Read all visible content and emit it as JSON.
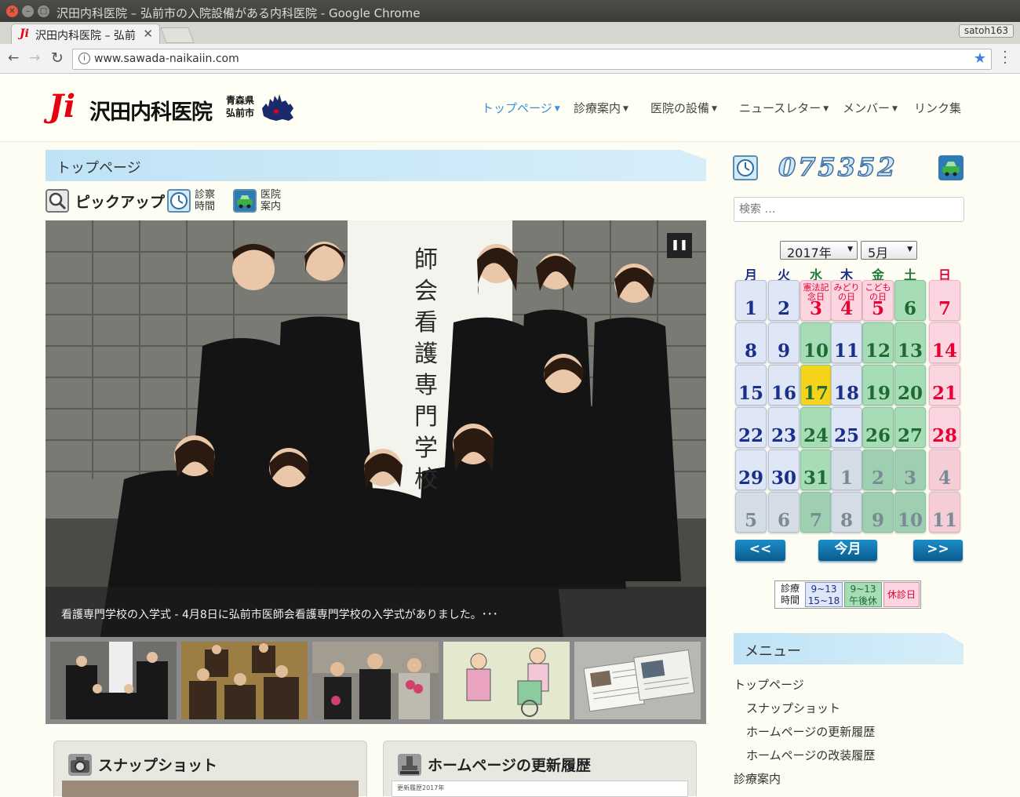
{
  "window": {
    "title": "沢田内科医院 – 弘前市の入院設備がある内科医院 - Google Chrome",
    "tab_title": "沢田内科医院 – 弘前",
    "profile": "satoh163",
    "url": "www.sawada-naikaiin.com"
  },
  "site": {
    "logo_mark": "Ji",
    "logo_text": "沢田内科医院",
    "logo_pref_1": "青森県",
    "logo_pref_2": "弘前市",
    "nav": [
      {
        "label": "トップページ",
        "dropdown": true,
        "active": true
      },
      {
        "label": "診療案内",
        "dropdown": true
      },
      {
        "label": "医院の設備",
        "dropdown": true
      },
      {
        "label": "ニュースレター",
        "dropdown": true
      },
      {
        "label": "メンバー",
        "dropdown": true
      },
      {
        "label": "リンク集",
        "dropdown": false
      }
    ]
  },
  "main": {
    "page_title": "トップページ",
    "pickup_label": "ピックアップ",
    "hours_link_1": "診察",
    "hours_link_2": "時間",
    "access_link_1": "医院",
    "access_link_2": "案内",
    "slide_caption": "看護専門学校の入学式 - 4月8日に弘前市医師会看護専門学校の入学式がありました。･･･",
    "cards": [
      {
        "title": "スナップショット",
        "icon": "camera-icon"
      },
      {
        "title": "ホームページの更新履歴",
        "icon": "stamp-icon",
        "preview_text": "更新履歴2017年"
      }
    ]
  },
  "sidebar": {
    "counter": "075352",
    "search_placeholder": "検索 …",
    "calendar": {
      "year": "2017年",
      "month": "5月",
      "weekdays": [
        "月",
        "火",
        "水",
        "木",
        "金",
        "土",
        "日"
      ],
      "today": "17",
      "prev_label": "<<",
      "today_label": "今月",
      "next_label": ">>",
      "holidays": {
        "3": "憲法記念日",
        "4": "みどりの日",
        "5": "こどもの日"
      }
    },
    "legend": {
      "label_1": "診療",
      "label_2": "時間",
      "normal_1": "9~13",
      "normal_2": "15~18",
      "half_1": "9~13",
      "half_2": "午後休",
      "closed": "休診日"
    },
    "menu_title": "メニュー",
    "menu_items": [
      {
        "label": "トップページ",
        "level": 0
      },
      {
        "label": "スナップショット",
        "level": 1
      },
      {
        "label": "ホームページの更新履歴",
        "level": 1
      },
      {
        "label": "ホームページの改装履歴",
        "level": 1
      },
      {
        "label": "診療案内",
        "level": 0
      }
    ]
  }
}
